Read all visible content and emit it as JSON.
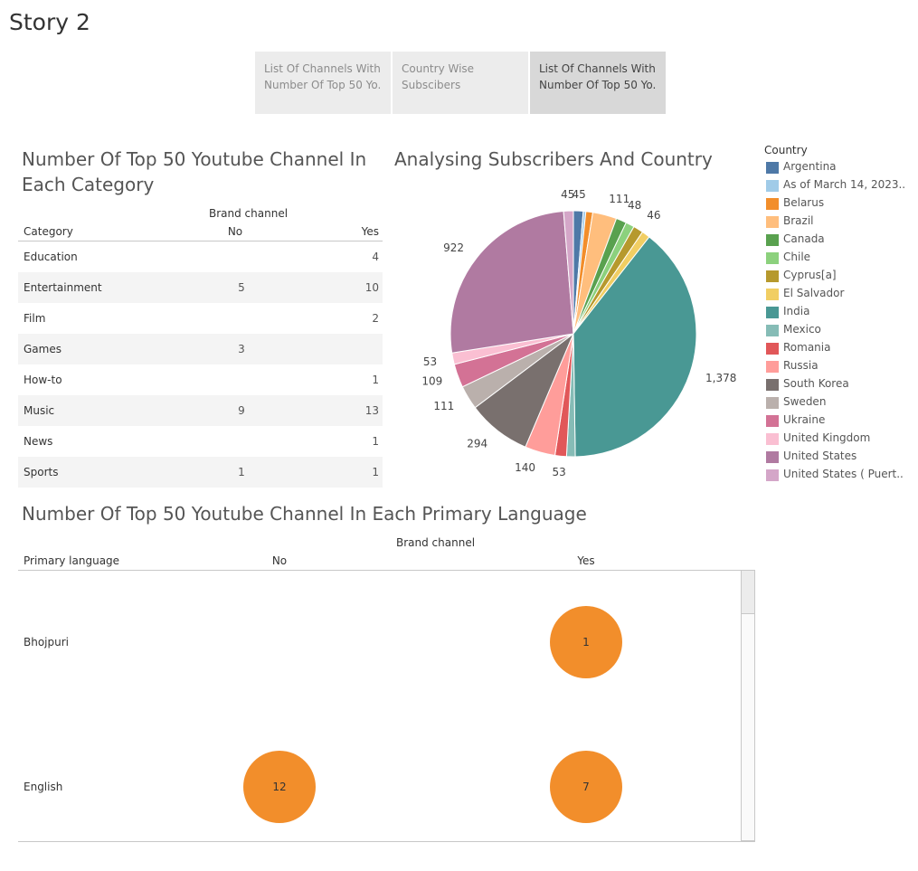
{
  "story": {
    "title": "Story 2",
    "tabs": [
      {
        "line1": "List Of Channels With",
        "line2": "Number Of Top 50 Yo..",
        "active": false
      },
      {
        "line1": "Country Wise",
        "line2": "Subscibers",
        "active": false
      },
      {
        "line1": "List Of Channels With",
        "line2": "Number Of Top 50 Yo..",
        "active": true
      }
    ]
  },
  "category_table": {
    "title_line1": "Number Of Top 50 Youtube Channel In",
    "title_line2": "Each Category",
    "group_header": "Brand channel",
    "row_header": "Category",
    "col_no": "No",
    "col_yes": "Yes",
    "rows": [
      {
        "category": "Education",
        "no": "",
        "yes": "4"
      },
      {
        "category": "Entertainment",
        "no": "5",
        "yes": "10"
      },
      {
        "category": "Film",
        "no": "",
        "yes": "2"
      },
      {
        "category": "Games",
        "no": "3",
        "yes": ""
      },
      {
        "category": "How-to",
        "no": "",
        "yes": "1"
      },
      {
        "category": "Music",
        "no": "9",
        "yes": "13"
      },
      {
        "category": "News",
        "no": "",
        "yes": "1"
      },
      {
        "category": "Sports",
        "no": "1",
        "yes": "1"
      }
    ]
  },
  "pie": {
    "title": "Analysing Subscribers And Country",
    "legend_title": "Country"
  },
  "chart_data": {
    "type": "pie",
    "title": "Analysing Subscribers And Country",
    "legend_title": "Country",
    "legend_placement": "right",
    "slices": [
      {
        "country": "Argentina",
        "value": 45,
        "label": "45",
        "color": "#4e79a7"
      },
      {
        "country": "As of March 14, 2023..",
        "value": 12,
        "label": "",
        "color": "#a0cbe8"
      },
      {
        "country": "Belarus",
        "value": 32,
        "label": "",
        "color": "#f28e2b"
      },
      {
        "country": "Brazil",
        "value": 111,
        "label": "111",
        "color": "#ffbe7d"
      },
      {
        "country": "Canada",
        "value": 48,
        "label": "48",
        "color": "#59a14f"
      },
      {
        "country": "Chile",
        "value": 40,
        "label": "",
        "color": "#8cd17d"
      },
      {
        "country": "Cyprus[a]",
        "value": 46,
        "label": "46",
        "color": "#b6992d"
      },
      {
        "country": "El Salvador",
        "value": 38,
        "label": "",
        "color": "#f1ce63"
      },
      {
        "country": "India",
        "value": 1378,
        "label": "1,378",
        "color": "#499894"
      },
      {
        "country": "Mexico",
        "value": 40,
        "label": "",
        "color": "#86bcb6"
      },
      {
        "country": "Romania",
        "value": 53,
        "label": "53",
        "color": "#e15759"
      },
      {
        "country": "Russia",
        "value": 140,
        "label": "140",
        "color": "#ff9d9a"
      },
      {
        "country": "South Korea",
        "value": 294,
        "label": "294",
        "color": "#79706e"
      },
      {
        "country": "Sweden",
        "value": 111,
        "label": "111",
        "color": "#bab0ac"
      },
      {
        "country": "Ukraine",
        "value": 109,
        "label": "109",
        "color": "#d37295"
      },
      {
        "country": "United Kingdom",
        "value": 53,
        "label": "53",
        "color": "#fabfd2"
      },
      {
        "country": "United States",
        "value": 922,
        "label": "922",
        "color": "#b07aa1"
      },
      {
        "country": "United States ( Puert..",
        "value": 45,
        "label": "45",
        "color": "#d4a6c8"
      }
    ]
  },
  "language_table": {
    "title": "Number Of Top 50 Youtube Channel In Each Primary Language",
    "group_header": "Brand channel",
    "row_header": "Primary language",
    "col_no": "No",
    "col_yes": "Yes",
    "rows": [
      {
        "language": "Bhojpuri",
        "no": "",
        "yes": "1"
      },
      {
        "language": "English",
        "no": "12",
        "yes": "7"
      }
    ]
  }
}
